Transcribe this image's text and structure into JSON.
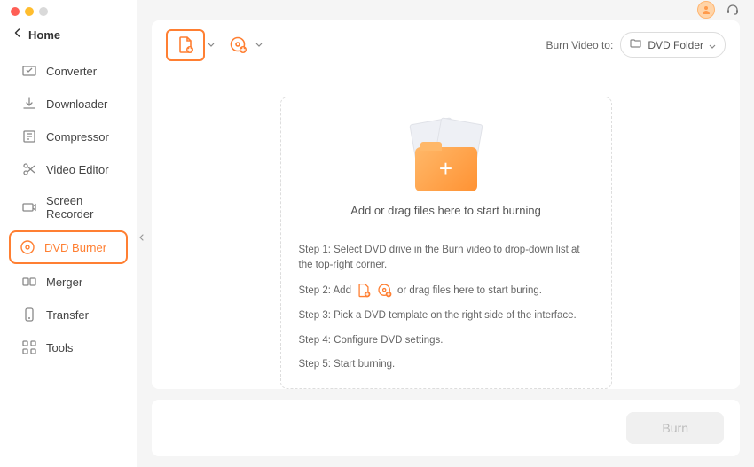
{
  "home": "Home",
  "nav": [
    {
      "label": "Converter",
      "icon": "converter"
    },
    {
      "label": "Downloader",
      "icon": "downloader"
    },
    {
      "label": "Compressor",
      "icon": "compressor"
    },
    {
      "label": "Video Editor",
      "icon": "editor"
    },
    {
      "label": "Screen Recorder",
      "icon": "recorder"
    },
    {
      "label": "DVD Burner",
      "icon": "burner",
      "active": true
    },
    {
      "label": "Merger",
      "icon": "merger"
    },
    {
      "label": "Transfer",
      "icon": "transfer"
    },
    {
      "label": "Tools",
      "icon": "tools"
    }
  ],
  "toolbar": {
    "burn_to_label": "Burn Video to:",
    "burn_to_value": "DVD Folder"
  },
  "drop": {
    "main_text": "Add or drag files here to start burning"
  },
  "steps": {
    "s1": "Step 1: Select DVD drive in the Burn video to drop-down list at the top-right corner.",
    "s2_prefix": "Step 2: Add",
    "s2_suffix": "or drag files here to start buring.",
    "s3": "Step 3: Pick a DVD template on the right side of the interface.",
    "s4": "Step 4: Configure DVD settings.",
    "s5": "Step 5: Start burning."
  },
  "footer": {
    "burn_label": "Burn"
  },
  "colors": {
    "accent": "#ff7f32"
  }
}
